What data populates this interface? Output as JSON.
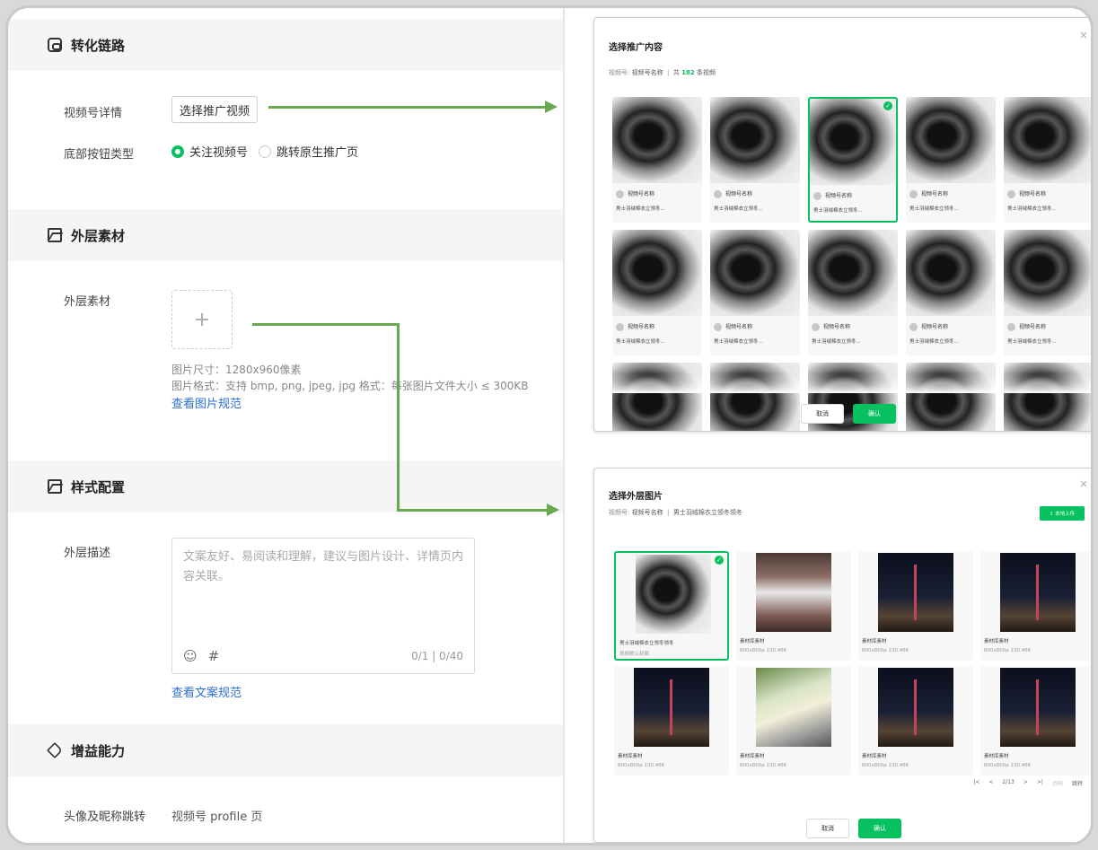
{
  "form": {
    "sections": {
      "conversion": "转化链路",
      "outer_material": "外层素材",
      "style_config": "样式配置",
      "gain": "增益能力"
    },
    "video_detail_label": "视频号详情",
    "select_video_button": "选择推广视频",
    "bottom_button_label": "底部按钮类型",
    "radio_options": [
      "关注视频号",
      "跳转原生推广页"
    ],
    "radio_selected": "关注视频号",
    "outer_material_label": "外层素材",
    "upload_plus": "+",
    "image_size_hint": "图片尺寸：1280x960像素",
    "image_format_hint": "图片格式：支持 bmp, png, jpeg, jpg 格式：每张图片文件大小 ≤ 300KB",
    "view_image_spec": "查看图片规范",
    "outer_desc_label": "外层描述",
    "outer_desc_placeholder": "文案友好、易阅读和理解，建议与图片设计、详情页内容关联。",
    "emoji_glyph": "☺",
    "hash_glyph": "#",
    "desc_count": "0/1  |  0/40",
    "view_copy_spec": "查看文案规范",
    "avatar_jump_label": "头像及昵称跳转",
    "avatar_jump_value": "视频号 profile 页"
  },
  "dialog_content": {
    "title": "选择推广内容",
    "sub_prefix": "视频号:",
    "sub_channel": "视频号名称",
    "sub_count_pre": "共",
    "sub_count": "182",
    "sub_count_post": "条视频",
    "card_name": "视频号名称",
    "card_title": "男士羽绒棉衣立领冬...",
    "cancel": "取消",
    "confirm": "确认",
    "close": "×"
  },
  "dialog_outer": {
    "title": "选择外层图片",
    "sub_prefix": "视频号:",
    "sub_channel": "视频号名称",
    "sub_video": "男士羽绒棉衣立领冬领冬",
    "upload": "⇪ 本地上传",
    "close": "×",
    "first_card_title": "男士羽绒棉衣立领冬领冬",
    "first_card_meta": "视频默认封面",
    "lib_card_title": "素材库素材",
    "lib_card_meta": "800x800p  130.46K",
    "pager": [
      "|<",
      "<",
      "2/13",
      ">",
      ">|",
      "页码",
      "跳转"
    ],
    "cancel": "取消",
    "confirm": "确认"
  },
  "colors": {
    "accent": "#07c160",
    "arrow": "#6aa84f",
    "link": "#2b6fd6"
  },
  "icons": {
    "conversion": "link-icon",
    "outer_material": "image-icon",
    "style_config": "image-icon",
    "gain": "tag-icon"
  }
}
